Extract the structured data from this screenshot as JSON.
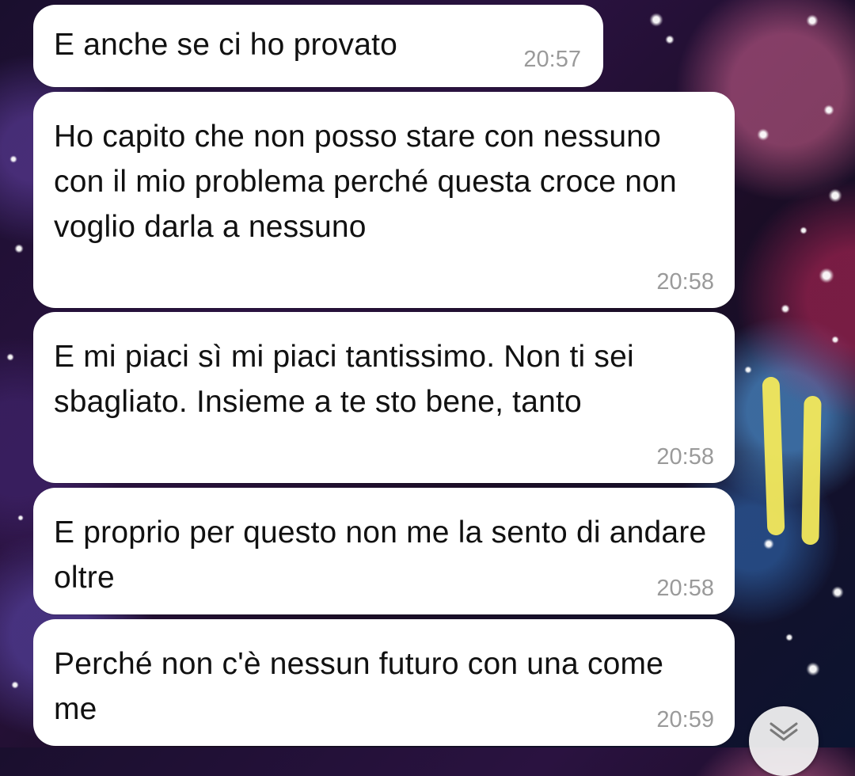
{
  "messages": [
    {
      "text": "E anche se ci ho provato",
      "time": "20:57"
    },
    {
      "text": "Ho capito che non posso stare con nessuno con il mio problema perché questa croce non voglio darla a nessuno",
      "time": "20:58"
    },
    {
      "text": "E mi piaci sì mi piaci tantissimo. Non ti sei sbagliato. Insieme a te sto bene, tanto",
      "time": "20:58"
    },
    {
      "text": "E proprio per questo non me la sento di andare oltre",
      "time": "20:58"
    },
    {
      "text": "Perché non c'è nessun futuro con una come me",
      "time": "20:59"
    }
  ],
  "scroll_button": {
    "icon": "double-chevron-down-icon"
  },
  "colors": {
    "bubble": "#ffffff",
    "timestamp": "#9a9a9a",
    "highlight_marker": "#f3e95b"
  }
}
